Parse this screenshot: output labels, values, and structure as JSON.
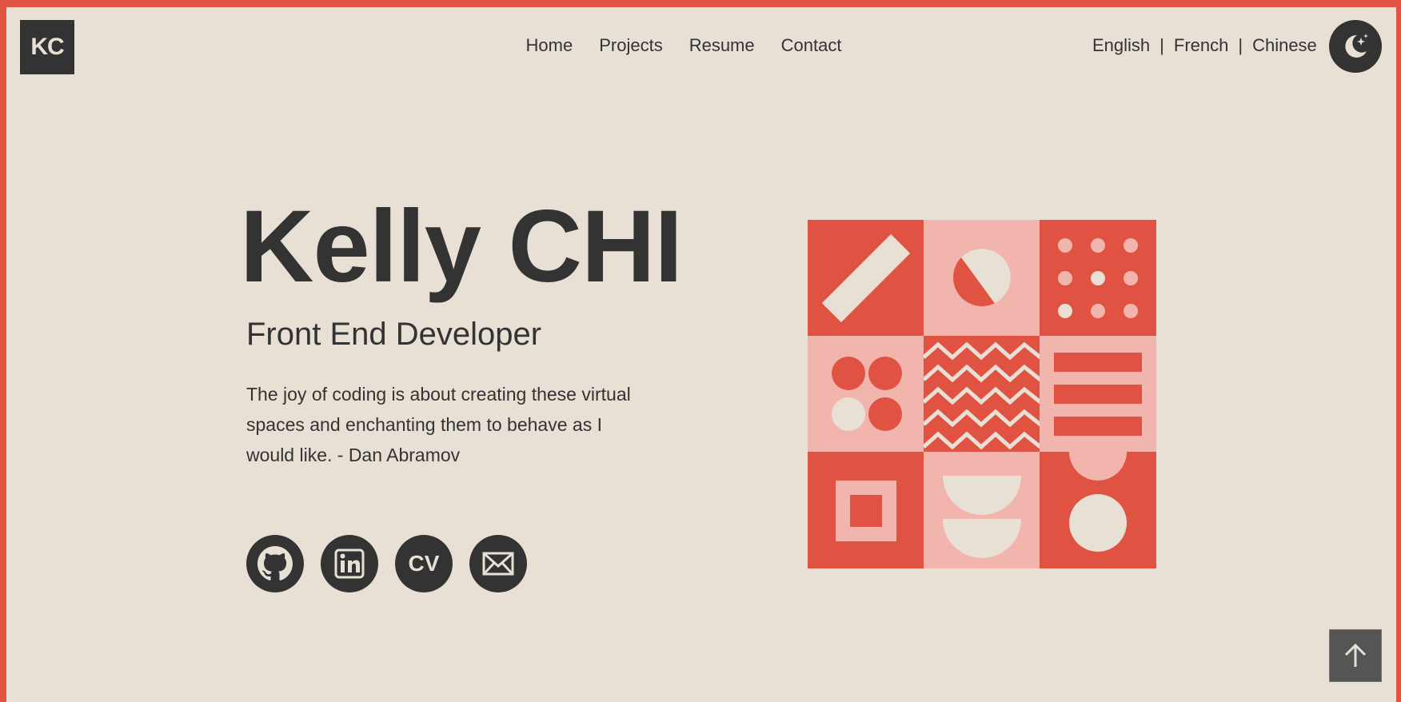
{
  "logo": {
    "text": "KC"
  },
  "nav": {
    "items": [
      "Home",
      "Projects",
      "Resume",
      "Contact"
    ]
  },
  "lang": {
    "items": [
      "English",
      "French",
      "Chinese"
    ],
    "separator": "|"
  },
  "theme_toggle": {
    "icon": "moon-stars-icon"
  },
  "hero": {
    "name": "Kelly CHI",
    "role": "Front End Developer",
    "quote": "The joy of coding is about creating these virtual spaces and enchanting them to behave as I would like. - Dan Abramov"
  },
  "socials": [
    {
      "icon": "github-icon"
    },
    {
      "icon": "linkedin-icon"
    },
    {
      "icon": "cv-icon",
      "label": "CV"
    },
    {
      "icon": "mail-icon"
    }
  ],
  "back_to_top": {
    "icon": "arrow-up-icon"
  },
  "colors": {
    "accent": "#e05242",
    "accent_light": "#f2b5ae",
    "background": "#e8e0d5",
    "dark": "#333333"
  }
}
